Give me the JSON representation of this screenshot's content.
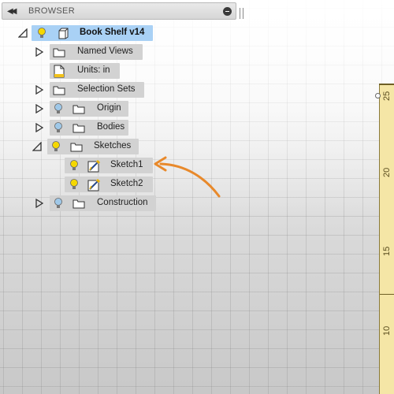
{
  "browser": {
    "title": "BROWSER",
    "root": {
      "label": "Book Shelf v14"
    },
    "items": [
      {
        "label": "Named Views"
      },
      {
        "label": "Units: in"
      },
      {
        "label": "Selection Sets"
      },
      {
        "label": "Origin"
      },
      {
        "label": "Bodies"
      },
      {
        "label": "Sketches"
      },
      {
        "label": "Sketch1"
      },
      {
        "label": "Sketch2"
      },
      {
        "label": "Construction"
      }
    ]
  },
  "ruler": {
    "ticks": [
      "25",
      "20",
      "15",
      "10"
    ]
  },
  "colors": {
    "selected": "#a9d1f5",
    "pill": "#d2d2d2",
    "arrow": "#e8892b",
    "bulb_on": "#f5d800",
    "bulb_off": "#9fc8e8",
    "ruler": "#f5e6a6"
  }
}
